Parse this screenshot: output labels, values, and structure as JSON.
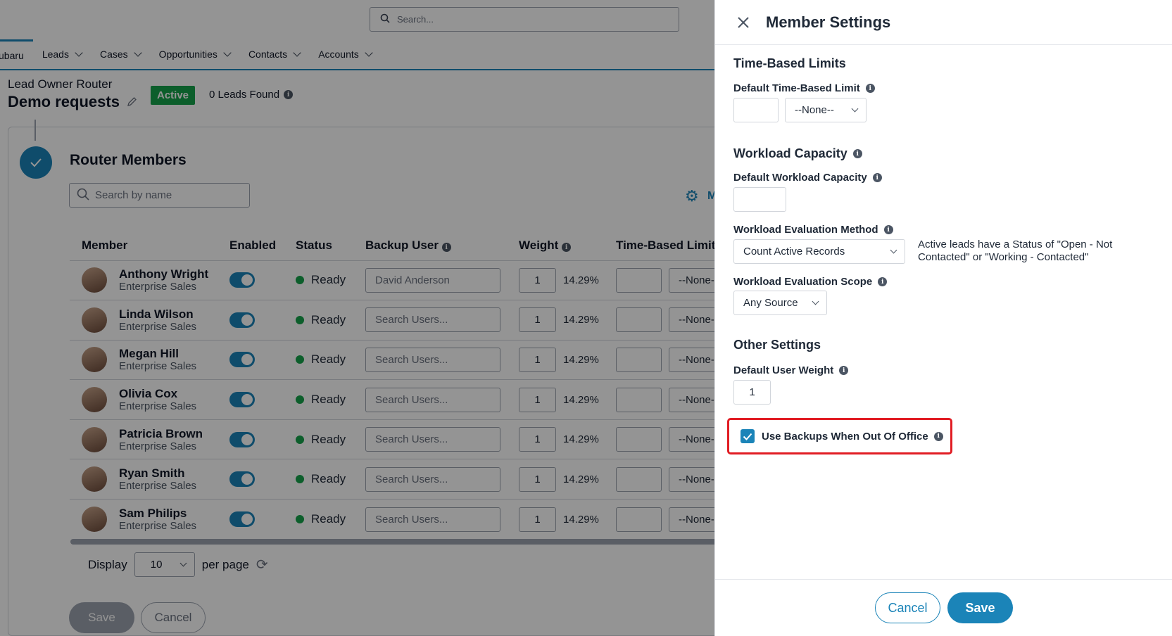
{
  "topbar": {
    "search_placeholder": "Search..."
  },
  "nav": {
    "tabs": [
      {
        "label": "ubaru"
      },
      {
        "label": "Leads"
      },
      {
        "label": "Cases"
      },
      {
        "label": "Opportunities"
      },
      {
        "label": "Contacts"
      },
      {
        "label": "Accounts"
      }
    ]
  },
  "router": {
    "subtitle": "Lead Owner Router",
    "name": "Demo requests",
    "status_badge": "Active",
    "leads_found": "0 Leads Found"
  },
  "members_section": {
    "title": "Router Members",
    "search_placeholder": "Search by name",
    "manage_label": "M",
    "columns": [
      "Member",
      "Enabled",
      "Status",
      "Backup User",
      "Weight",
      "Time-Based Limit"
    ],
    "rows": [
      {
        "name": "Anthony Wright",
        "role": "Enterprise Sales",
        "status": "Ready",
        "backup": "David Anderson",
        "weight": "1",
        "pct": "14.29%",
        "limit_unit": "--None--"
      },
      {
        "name": "Linda Wilson",
        "role": "Enterprise Sales",
        "status": "Ready",
        "backup": "Search Users...",
        "weight": "1",
        "pct": "14.29%",
        "limit_unit": "--None--"
      },
      {
        "name": "Megan Hill",
        "role": "Enterprise Sales",
        "status": "Ready",
        "backup": "Search Users...",
        "weight": "1",
        "pct": "14.29%",
        "limit_unit": "--None--"
      },
      {
        "name": "Olivia Cox",
        "role": "Enterprise Sales",
        "status": "Ready",
        "backup": "Search Users...",
        "weight": "1",
        "pct": "14.29%",
        "limit_unit": "--None--"
      },
      {
        "name": "Patricia Brown",
        "role": "Enterprise Sales",
        "status": "Ready",
        "backup": "Search Users...",
        "weight": "1",
        "pct": "14.29%",
        "limit_unit": "--None--"
      },
      {
        "name": "Ryan Smith",
        "role": "Enterprise Sales",
        "status": "Ready",
        "backup": "Search Users...",
        "weight": "1",
        "pct": "14.29%",
        "limit_unit": "--None--"
      },
      {
        "name": "Sam Philips",
        "role": "Enterprise Sales",
        "status": "Ready",
        "backup": "Search Users...",
        "weight": "1",
        "pct": "14.29%",
        "limit_unit": "--None--"
      }
    ],
    "display_label": "Display",
    "per_page_value": "10",
    "per_page_label": "per page",
    "save_label": "Save",
    "cancel_label": "Cancel"
  },
  "panel": {
    "title": "Member Settings",
    "time_section": "Time-Based Limits",
    "default_time_label": "Default Time-Based Limit",
    "default_time_value": "",
    "default_time_unit": "--None--",
    "workload_section": "Workload Capacity",
    "default_capacity_label": "Default Workload Capacity",
    "default_capacity_value": "",
    "eval_method_label": "Workload Evaluation Method",
    "eval_method_value": "Count Active Records",
    "eval_method_note": "Active leads have a Status of \"Open - Not Contacted\" or \"Working - Contacted\"",
    "eval_scope_label": "Workload Evaluation Scope",
    "eval_scope_value": "Any Source",
    "other_section": "Other Settings",
    "default_weight_label": "Default User Weight",
    "default_weight_value": "1",
    "use_backups_label": "Use Backups When Out Of Office",
    "use_backups_checked": true,
    "cancel_label": "Cancel",
    "save_label": "Save"
  },
  "colors": {
    "accent": "#1b84b8",
    "active_green": "#16a34a",
    "highlight_red": "#e11d24"
  }
}
